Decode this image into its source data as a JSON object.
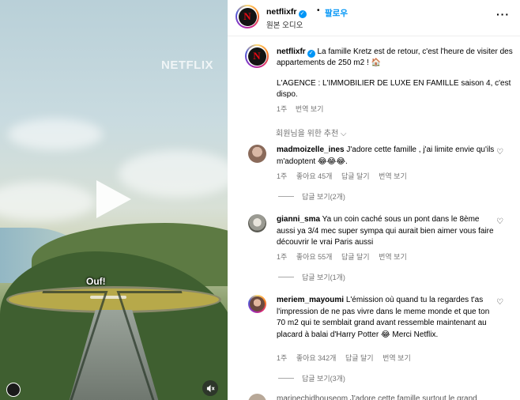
{
  "media": {
    "watermark": "NETFLIX",
    "caption": "Ouf!",
    "play_icon": "play-icon",
    "mute_icon": "mute-icon"
  },
  "header": {
    "username": "netflixfr",
    "dot": "•",
    "follow": "팔로우",
    "subtitle": "원본 오디오",
    "more": "···",
    "avatar_letter": "N"
  },
  "post": {
    "username": "netflixfr",
    "text_line1": "La famille Kretz est de retour, c'est l'heure de visiter des appartements de 250 m2 ! 🏠",
    "text_line2": "L'AGENCE : L'IMMOBILIER DE LUXE EN FAMILLE saison 4, c'est dispo.",
    "time": "1주",
    "translate": "번역 보기"
  },
  "recommend_label": "회원님을 위한 추천 ⌵",
  "comments": [
    {
      "username": "madmoizelle_ines",
      "text": "J'adore cette famille , j'ai limite envie qu'ils m'adoptent 😂😂😂.",
      "time": "1주",
      "likes": "좋아요 45개",
      "reply": "답글 달기",
      "translate": "번역 보기",
      "view_replies": "답글 보기(2개)",
      "avatar_color": "#8a6a5a"
    },
    {
      "username": "gianni_sma",
      "text": "Ya un coin caché sous un pont dans le 8ème aussi ya 3/4 mec super sympa qui aurait bien aimer vous faire découvrir le vrai Paris aussi",
      "time": "1주",
      "likes": "좋아요 55개",
      "reply": "답글 달기",
      "translate": "번역 보기",
      "view_replies": "답글 보기(1개)",
      "avatar_color": "#9a9a92"
    },
    {
      "username": "meriem_mayoumi",
      "text": "L'émission où quand tu la regardes t'as l'impression de ne pas vivre dans le meme monde et que ton 70 m2 qui te semblait grand avant ressemble maintenant au placard à balai d'Harry Potter 😂 Merci Netflix.",
      "time": "1주",
      "likes": "좋아요 342개",
      "reply": "답글 달기",
      "translate": "번역 보기",
      "view_replies": "답글 보기(3개)",
      "avatar_color": "#6b4a3e"
    }
  ],
  "partial_comment": "marinechidhouseom J'adore cette famille surtout le grand"
}
